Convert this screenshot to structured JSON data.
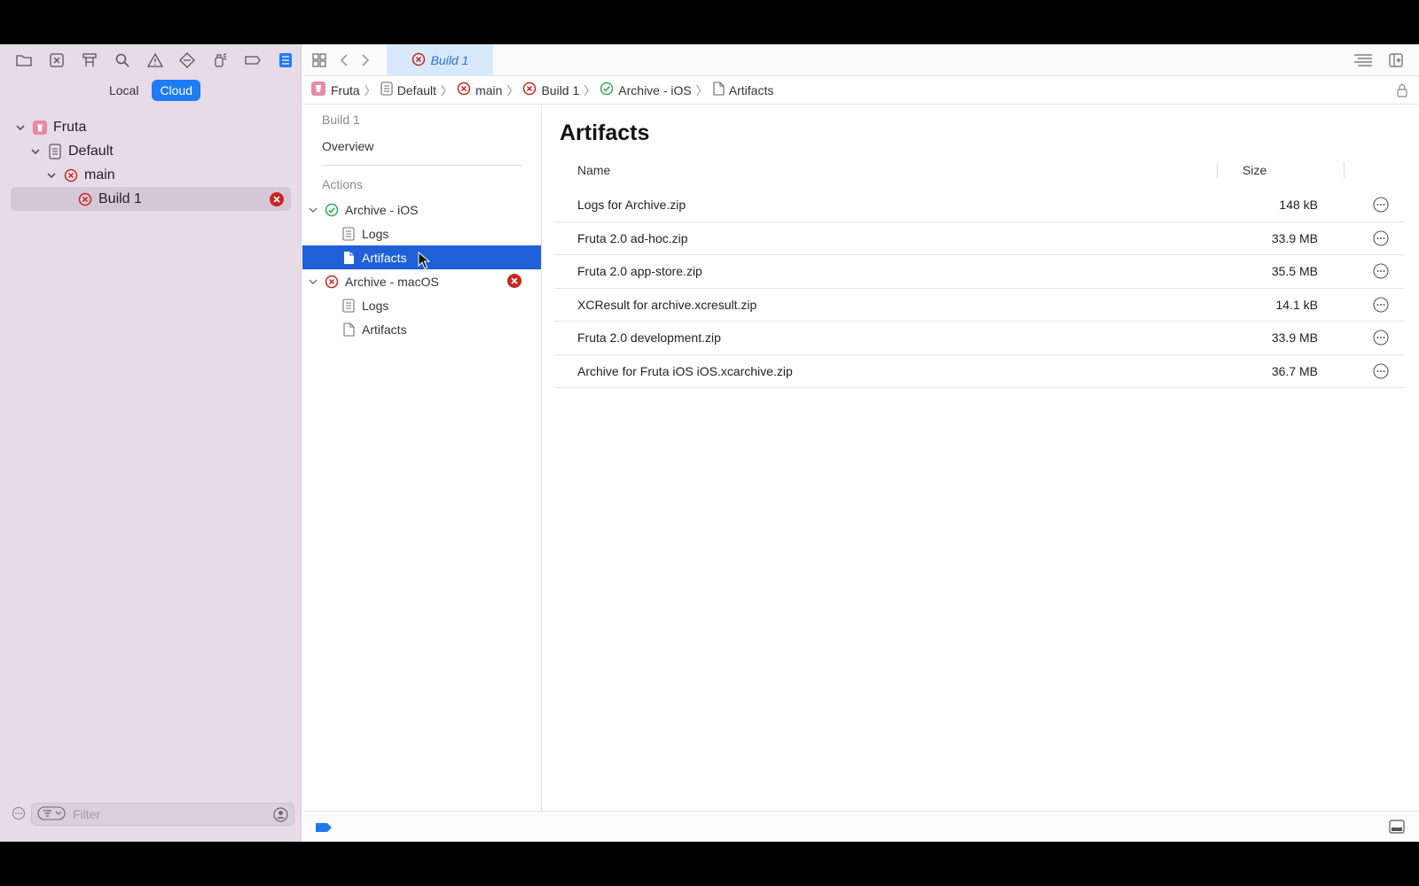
{
  "navigator": {
    "toolbar_icons": [
      "folder-icon",
      "source-control-icon",
      "symbol-hierarchy-icon",
      "search-icon",
      "warning-icon",
      "test-diamond-icon",
      "debug-spray-icon",
      "breakpoint-icon",
      "report-icon"
    ],
    "scope": {
      "local_label": "Local",
      "cloud_label": "Cloud",
      "active": "Cloud"
    },
    "tree": [
      {
        "label": "Fruta",
        "level": 0,
        "icon": "app-icon",
        "expanded": true
      },
      {
        "label": "Default",
        "level": 1,
        "icon": "document-icon",
        "expanded": true
      },
      {
        "label": "main",
        "level": 2,
        "icon": "error-icon",
        "expanded": true
      },
      {
        "label": "Build 1",
        "level": 3,
        "icon": "error-icon",
        "selected": true,
        "badge": "error-badge-icon"
      }
    ],
    "filter": {
      "placeholder": "Filter"
    }
  },
  "tabbar": {
    "active_tab_label": "Build 1"
  },
  "jumpbar": {
    "crumbs": [
      {
        "label": "Fruta",
        "icon": "app-icon"
      },
      {
        "label": "Default",
        "icon": "document-icon"
      },
      {
        "label": "main",
        "icon": "error-icon"
      },
      {
        "label": "Build 1",
        "icon": "error-icon"
      },
      {
        "label": "Archive - iOS",
        "icon": "success-icon"
      },
      {
        "label": "Artifacts",
        "icon": "file-icon"
      }
    ]
  },
  "outline": {
    "build_label": "Build 1",
    "overview_label": "Overview",
    "actions_label": "Actions",
    "groups": [
      {
        "label": "Archive - iOS",
        "status": "success",
        "children": [
          {
            "label": "Logs",
            "icon": "log-icon"
          },
          {
            "label": "Artifacts",
            "icon": "file-icon",
            "selected": true
          }
        ]
      },
      {
        "label": "Archive - macOS",
        "status": "error",
        "badge": "error-badge-icon",
        "children": [
          {
            "label": "Logs",
            "icon": "log-icon"
          },
          {
            "label": "Artifacts",
            "icon": "file-icon"
          }
        ]
      }
    ]
  },
  "content": {
    "title": "Artifacts",
    "columns": {
      "name": "Name",
      "size": "Size"
    },
    "artifacts": [
      {
        "name": "Logs for Archive.zip",
        "size": "148 kB"
      },
      {
        "name": "Fruta 2.0 ad-hoc.zip",
        "size": "33.9 MB"
      },
      {
        "name": "Fruta 2.0 app-store.zip",
        "size": "35.5 MB"
      },
      {
        "name": "XCResult for archive.xcresult.zip",
        "size": "14.1 kB"
      },
      {
        "name": "Fruta 2.0 development.zip",
        "size": "33.9 MB"
      },
      {
        "name": "Archive for Fruta iOS iOS.xcarchive.zip",
        "size": "36.7 MB"
      }
    ]
  },
  "colors": {
    "accent": "#1e7bf2",
    "selection": "#1f5fd8",
    "error": "#c8271e",
    "success": "#34a853",
    "sidebar_bg": "#e8dbe8"
  }
}
